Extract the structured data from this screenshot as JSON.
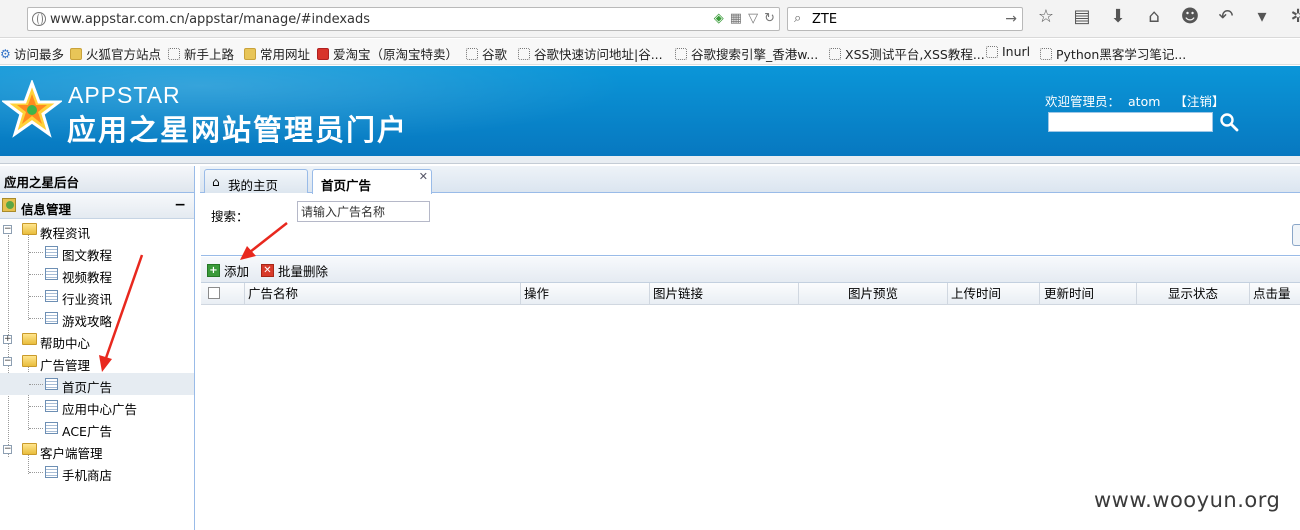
{
  "browser": {
    "url": "www.appstar.com.cn/appstar/manage/#indexads",
    "search_value": "ZTE",
    "bookmarks": [
      {
        "label": "访问最多",
        "icon": "gear-icon"
      },
      {
        "label": "火狐官方站点",
        "icon": "folder-icon"
      },
      {
        "label": "新手上路",
        "icon": "page-icon"
      },
      {
        "label": "常用网址",
        "icon": "folder-icon"
      },
      {
        "label": "爱淘宝（原淘宝特卖）",
        "icon": "taobao-icon"
      },
      {
        "label": "谷歌",
        "icon": "page-icon"
      },
      {
        "label": "谷歌快速访问地址|谷...",
        "icon": "page-icon"
      },
      {
        "label": "谷歌搜索引擎_香港w...",
        "icon": "page-icon"
      },
      {
        "label": "XSS测试平台,XSS教程...",
        "icon": "page-icon"
      },
      {
        "label": "Inurl",
        "icon": "page-icon"
      },
      {
        "label": "Python黑客学习笔记...",
        "icon": "page-icon"
      }
    ]
  },
  "header": {
    "brand_en": "APPSTAR",
    "brand_cn": "应用之星网站管理员门户",
    "welcome_label": "欢迎管理员：",
    "username": "atom",
    "logout_label": "【注销】"
  },
  "sidebar": {
    "title": "应用之星后台",
    "group_label": "信息管理",
    "tree": [
      {
        "label": "教程资讯",
        "type": "folder",
        "expanded": true
      },
      {
        "label": "图文教程",
        "type": "page"
      },
      {
        "label": "视频教程",
        "type": "page"
      },
      {
        "label": "行业资讯",
        "type": "page"
      },
      {
        "label": "游戏攻略",
        "type": "page"
      },
      {
        "label": "帮助中心",
        "type": "folder",
        "expanded": false
      },
      {
        "label": "广告管理",
        "type": "folder",
        "expanded": true
      },
      {
        "label": "首页广告",
        "type": "page",
        "selected": true
      },
      {
        "label": "应用中心广告",
        "type": "page"
      },
      {
        "label": "ACE广告",
        "type": "page"
      },
      {
        "label": "客户端管理",
        "type": "folder",
        "expanded": true
      },
      {
        "label": "手机商店",
        "type": "page"
      }
    ]
  },
  "tabs": [
    {
      "label": "我的主页",
      "active": false
    },
    {
      "label": "首页广告",
      "active": true
    }
  ],
  "search_panel": {
    "label": "搜索：",
    "placeholder": "请输入广告名称"
  },
  "toolbar": {
    "add_label": "添加",
    "batch_delete_label": "批量删除"
  },
  "grid": {
    "columns": [
      "广告名称",
      "操作",
      "图片链接",
      "图片预览",
      "上传时间",
      "更新时间",
      "显示状态",
      "点击量"
    ]
  },
  "watermark": "www.wooyun.org",
  "colors": {
    "header_blue": "#0a8ed2",
    "annotation_red": "#e8281e",
    "panel_border": "#99bbe8"
  }
}
